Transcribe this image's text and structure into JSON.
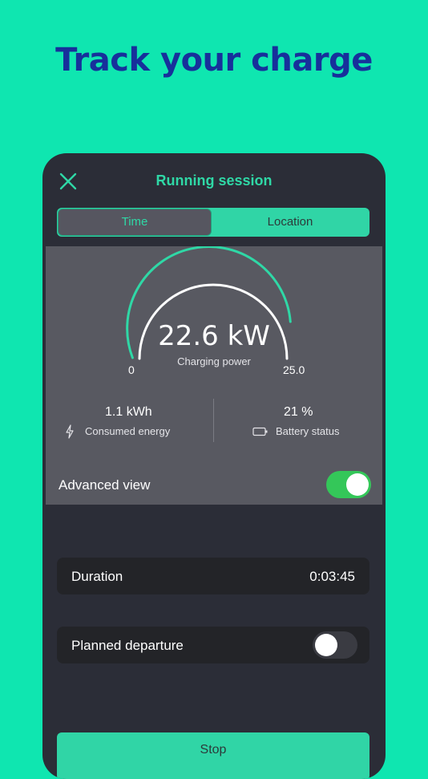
{
  "headline": "Track your charge",
  "screen": {
    "title": "Running session",
    "tabs": [
      {
        "label": "Time",
        "active": true
      },
      {
        "label": "Location",
        "active": false
      }
    ]
  },
  "gauge": {
    "value_text": "22.6 kW",
    "caption": "Charging power",
    "min_label": "0",
    "max_label": "25.0",
    "value": 22.6,
    "max": 25.0
  },
  "stats": {
    "energy": {
      "value": "1.1 kWh",
      "label": "Consumed energy",
      "icon": "lightning-icon"
    },
    "battery": {
      "value": "21 %",
      "label": "Battery status",
      "icon": "battery-icon"
    }
  },
  "advanced_view": {
    "label": "Advanced view",
    "on": true
  },
  "duration": {
    "label": "Duration",
    "value": "0:03:45"
  },
  "planned_departure": {
    "label": "Planned departure",
    "on": false
  },
  "stop_label": "Stop",
  "colors": {
    "background": "#0fe6b0",
    "headline": "#17309b",
    "accent": "#30d5a6",
    "panel": "#2b2d37",
    "toggle_on": "#34c759"
  }
}
